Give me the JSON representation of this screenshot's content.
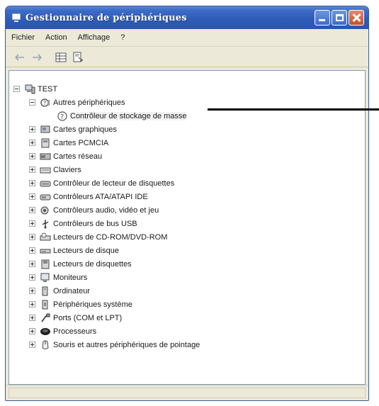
{
  "window": {
    "title": "Gestionnaire de périphériques"
  },
  "menu": {
    "items": [
      "Fichier",
      "Action",
      "Affichage",
      "?"
    ]
  },
  "toolbar": {
    "icons": [
      "back-arrow-icon",
      "forward-arrow-icon",
      "properties-grid-icon",
      "help-sheet-icon"
    ]
  },
  "tree": {
    "root": "TEST",
    "other_devices": "Autres périphériques",
    "mass_storage": "Contrôleur de stockage de masse",
    "categories": [
      {
        "label": "Cartes graphiques",
        "icon": "display-adapter-icon"
      },
      {
        "label": "Cartes PCMCIA",
        "icon": "pcmcia-icon"
      },
      {
        "label": "Cartes réseau",
        "icon": "network-card-icon"
      },
      {
        "label": "Claviers",
        "icon": "keyboard-icon"
      },
      {
        "label": "Contrôleur de lecteur de disquettes",
        "icon": "floppy-controller-icon"
      },
      {
        "label": "Contrôleurs ATA/ATAPI IDE",
        "icon": "ide-controller-icon"
      },
      {
        "label": "Contrôleurs audio, vidéo et jeu",
        "icon": "audio-icon"
      },
      {
        "label": "Contrôleurs de bus USB",
        "icon": "usb-icon"
      },
      {
        "label": "Lecteurs de CD-ROM/DVD-ROM",
        "icon": "cdrom-icon"
      },
      {
        "label": "Lecteurs de disque",
        "icon": "disk-drive-icon"
      },
      {
        "label": "Lecteurs de disquettes",
        "icon": "floppy-drive-icon"
      },
      {
        "label": "Moniteurs",
        "icon": "monitor-icon"
      },
      {
        "label": "Ordinateur",
        "icon": "computer-icon"
      },
      {
        "label": "Périphériques système",
        "icon": "system-device-icon"
      },
      {
        "label": "Ports (COM et LPT)",
        "icon": "port-icon"
      },
      {
        "label": "Processeurs",
        "icon": "processor-icon"
      },
      {
        "label": "Souris et autres périphériques de pointage",
        "icon": "mouse-icon"
      }
    ]
  },
  "colors": {
    "titlebar": "#2f5cb8",
    "chrome": "#ece9d8",
    "pane_border": "#7f9db9"
  }
}
